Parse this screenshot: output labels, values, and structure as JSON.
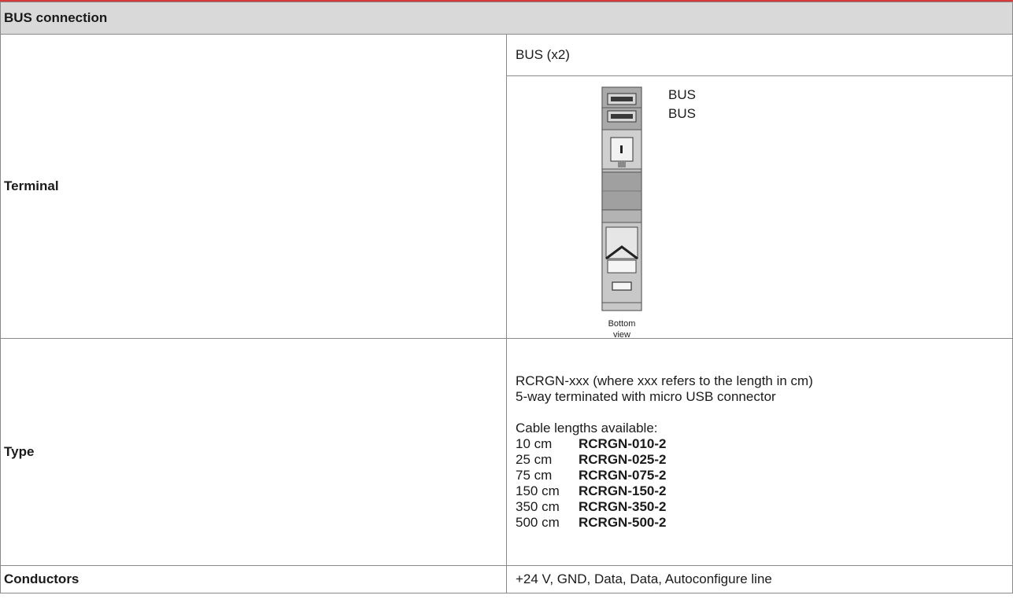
{
  "section_title": "BUS connection",
  "terminal": {
    "label": "Terminal",
    "spec": "BUS (x2)",
    "port_labels": [
      "BUS",
      "BUS"
    ],
    "caption_line1": "Bottom",
    "caption_line2": "view"
  },
  "type": {
    "label": "Type",
    "line1": "RCRGN-xxx (where xxx refers to the length in cm)",
    "line2": "5-way terminated with micro USB connector",
    "lengths_heading": "Cable lengths available:",
    "lengths": [
      {
        "length": "10 cm",
        "code": "RCRGN-010-2"
      },
      {
        "length": "25 cm",
        "code": "RCRGN-025-2"
      },
      {
        "length": "75 cm",
        "code": "RCRGN-075-2"
      },
      {
        "length": "150 cm",
        "code": "RCRGN-150-2"
      },
      {
        "length": "350 cm",
        "code": "RCRGN-350-2"
      },
      {
        "length": "500 cm",
        "code": "RCRGN-500-2"
      }
    ]
  },
  "conductors": {
    "label": "Conductors",
    "value": "+24 V, GND, Data, Data, Autoconfigure line"
  },
  "colors": {
    "header_bg": "#d9d9d9",
    "top_rule": "#d43a3a",
    "border": "#8a8a8a"
  }
}
